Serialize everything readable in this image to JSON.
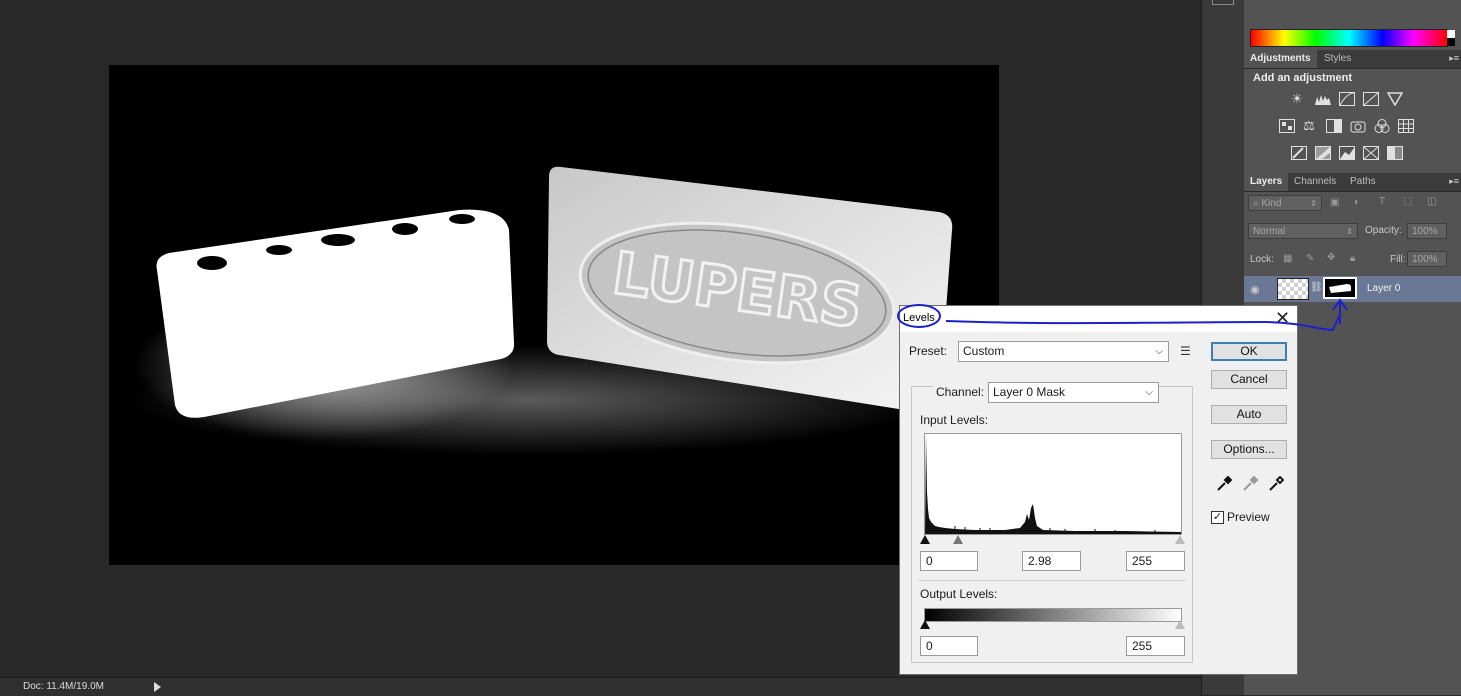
{
  "status": {
    "doc_size": "Doc: 11.4M/19.0M"
  },
  "panels": {
    "adjustments": {
      "tabs": [
        "Adjustments",
        "Styles"
      ],
      "title": "Add an adjustment",
      "icons_row1": [
        "brightness-contrast-icon",
        "levels-icon",
        "curves-icon",
        "exposure-icon",
        "vibrance-icon"
      ],
      "icons_row2": [
        "hue-saturation-icon",
        "color-balance-icon",
        "black-white-icon",
        "photo-filter-icon",
        "channel-mixer-icon",
        "color-lookup-icon"
      ],
      "icons_row3": [
        "invert-icon",
        "posterize-icon",
        "threshold-icon",
        "selective-color-icon",
        "gradient-map-icon"
      ]
    },
    "layers": {
      "tabs": [
        "Layers",
        "Channels",
        "Paths"
      ],
      "kind_label": "Kind",
      "blend_mode": "Normal",
      "opacity_label": "Opacity:",
      "opacity_value": "100%",
      "lock_label": "Lock:",
      "fill_label": "Fill:",
      "fill_value": "100%",
      "layer_name": "Layer 0"
    }
  },
  "dialog": {
    "title": "Levels",
    "preset_label": "Preset:",
    "preset_value": "Custom",
    "channel_label": "Channel:",
    "channel_value": "Layer 0 Mask",
    "input_levels_label": "Input Levels:",
    "input_black": "0",
    "input_gamma": "2.98",
    "input_white": "255",
    "output_levels_label": "Output Levels:",
    "output_black": "0",
    "output_white": "255",
    "buttons": {
      "ok": "OK",
      "cancel": "Cancel",
      "auto": "Auto",
      "options": "Options..."
    },
    "preview_label": "Preview",
    "preview_checked": true
  },
  "image": {
    "logo_text": "LUPERS"
  },
  "colors": {
    "annotation": "#1c22c8",
    "selection": "#6b7895",
    "default_button": "#3c7fb1"
  }
}
